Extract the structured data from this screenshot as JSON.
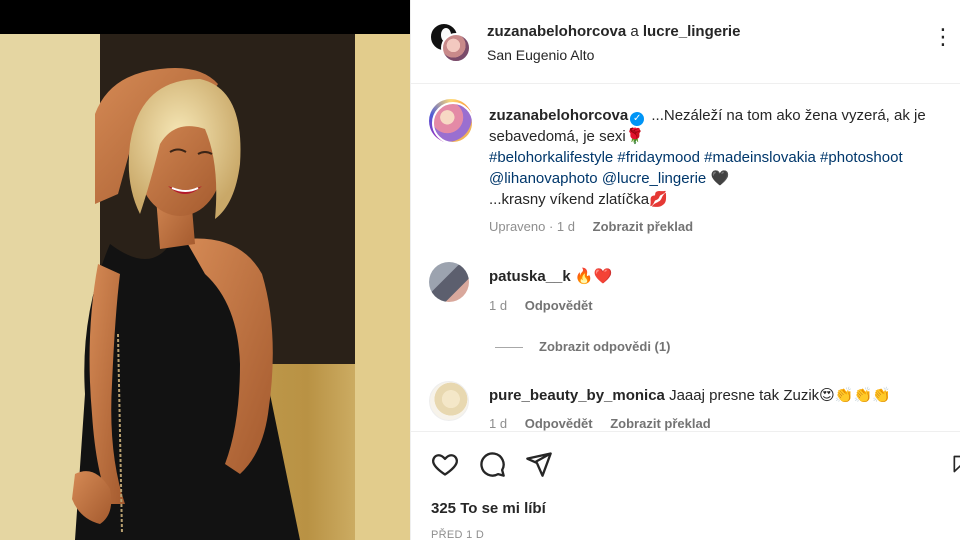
{
  "header": {
    "username": "zuzanabelohorcova",
    "joiner": "a",
    "collaborator": "lucre_lingerie",
    "location": "San Eugenio Alto",
    "more_icon": "more-horizontal-icon"
  },
  "caption": {
    "username": "zuzanabelohorcova",
    "verified_icon": "verified-badge-icon",
    "text": "...Nezáleží na tom ako žena vyzerá, ak je sebavedomá, je sexi",
    "emoji_1": "🌹",
    "hashtags": [
      "#belohorkalifestyle",
      "#fridaymood",
      "#madeinslovakia",
      "#photoshoot"
    ],
    "mentions": [
      "@lihanovaphoto",
      "@lucre_lingerie"
    ],
    "emoji_2": "🖤",
    "line3": "...krasny víkend zlatíčka",
    "emoji_3": "💋",
    "meta_edited": "Upraveno · 1 d",
    "meta_translate": "Zobrazit překlad"
  },
  "comments": [
    {
      "username": "patuska__k",
      "text": "🔥❤️",
      "time": "1 d",
      "reply": "Odpovědět",
      "show_replies": "Zobrazit odpovědi (1)"
    },
    {
      "username": "pure_beauty_by_monica",
      "text": "Jaaaj presne tak Zuzik😍👏👏👏",
      "time": "1 d",
      "reply": "Odpovědět",
      "translate": "Zobrazit překlad"
    }
  ],
  "actions": {
    "like_icon": "heart-icon",
    "comment_icon": "comment-icon",
    "share_icon": "paper-plane-icon",
    "save_icon": "bookmark-icon",
    "likes_text": "325 To se mi líbí",
    "posted_ago": "PŘED 1 D"
  },
  "colors": {
    "link": "#00376b",
    "verified": "#0095f6",
    "muted": "#8e8e8e"
  }
}
